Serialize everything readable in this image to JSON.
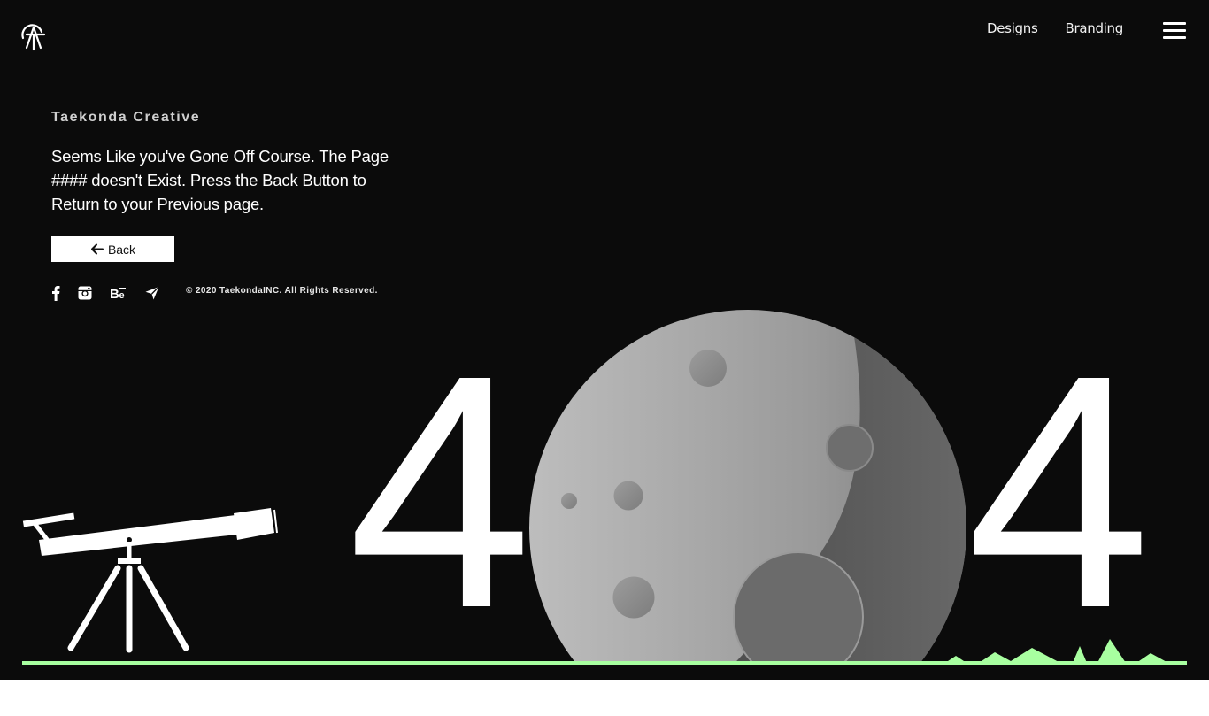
{
  "header": {
    "nav": [
      "Designs",
      "Branding"
    ]
  },
  "content": {
    "brand": "Taekonda Creative",
    "message": "Seems Like you've Gone Off Course. The Page #### doesn't Exist. Press the Back Button to Return to your Previous page.",
    "back_label": "Back",
    "copyright": "© 2020 TaekondaINC. All Rights Reserved."
  },
  "social": [
    "facebook-icon",
    "instagram-icon",
    "behance-icon",
    "telegram-icon"
  ],
  "illustration": {
    "left_digit": "4",
    "right_digit": "4"
  },
  "colors": {
    "background": "#0b0b0b",
    "ground": "#a8ffa0",
    "moon_light": "#bdbdbd",
    "moon_dark": "#5e5e5e"
  }
}
